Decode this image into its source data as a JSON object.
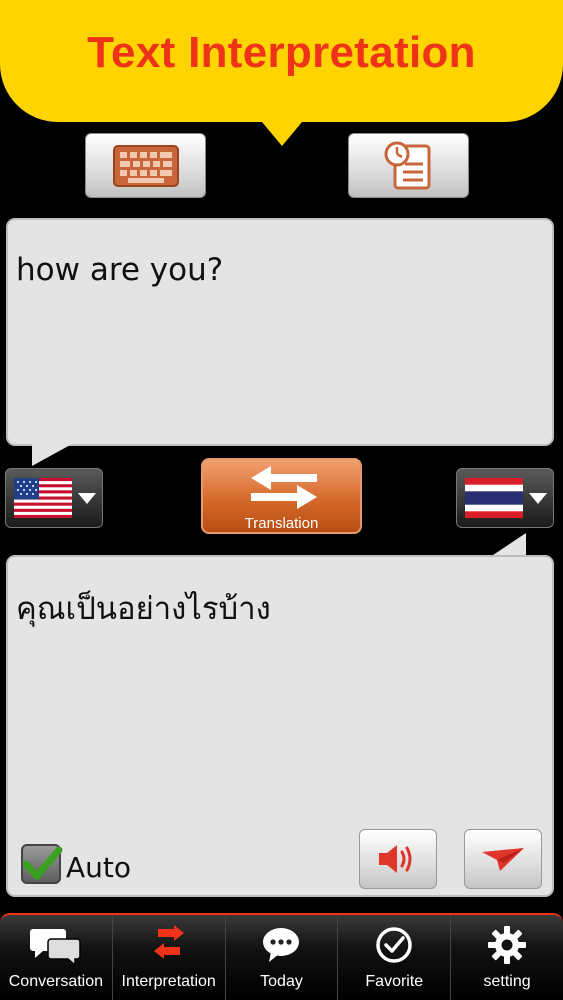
{
  "header": {
    "title": "Text Interpretation"
  },
  "toolbar": {
    "keyboard_icon": "keyboard-icon",
    "history_icon": "clock-notes-icon"
  },
  "source": {
    "text": "how are you?",
    "language_flag": "us-flag-icon"
  },
  "target": {
    "text": "คุณเป็นอย่างไรบ้าง",
    "language_flag": "thailand-flag-icon"
  },
  "translate": {
    "label": "Translation",
    "icon": "swap-arrows-icon"
  },
  "auto": {
    "label": "Auto",
    "checked": true
  },
  "actions": {
    "speak_icon": "speaker-icon",
    "send_icon": "paper-plane-icon"
  },
  "tabs": [
    {
      "label": "Conversation",
      "icon": "chat-bubbles-icon"
    },
    {
      "label": "Interpretation",
      "icon": "swap-arrows-icon"
    },
    {
      "label": "Today",
      "icon": "speech-bubble-icon"
    },
    {
      "label": "Favorite",
      "icon": "check-circle-icon"
    },
    {
      "label": "setting",
      "icon": "gear-icon"
    }
  ],
  "colors": {
    "banner": "#ffd400",
    "title": "#ee3319",
    "accent": "#d66a2c",
    "check": "#3aa020"
  }
}
